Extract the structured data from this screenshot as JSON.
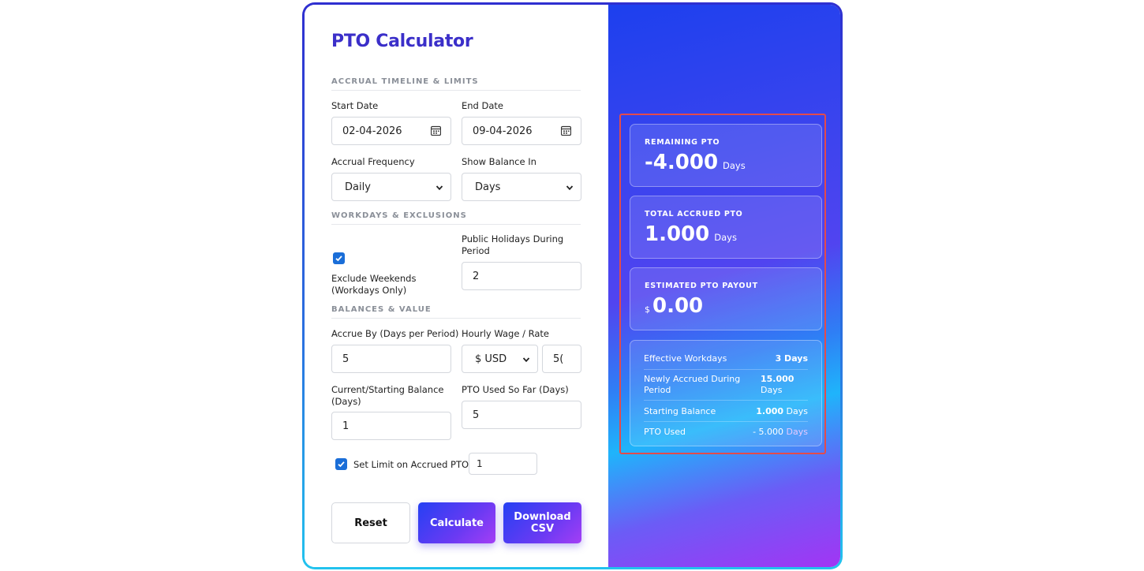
{
  "app": {
    "title": "PTO Calculator"
  },
  "sections": {
    "timeline": "ACCRUAL TIMELINE & LIMITS",
    "workdays": "WORKDAYS & EXCLUSIONS",
    "balances": "BALANCES & VALUE"
  },
  "form": {
    "start_date": {
      "label": "Start Date",
      "value": "02-04-2026"
    },
    "end_date": {
      "label": "End Date",
      "value": "09-04-2026"
    },
    "frequency": {
      "label": "Accrual Frequency",
      "value": "Daily"
    },
    "show_balance": {
      "label": "Show Balance In",
      "value": "Days"
    },
    "exclude_weekends": {
      "label": "Exclude Weekends (Workdays Only)",
      "checked": true
    },
    "holidays": {
      "label": "Public Holidays During Period",
      "value": "2"
    },
    "accrue_by": {
      "label": "Accrue By (Days per Period)",
      "value": "5"
    },
    "wage": {
      "label": "Hourly Wage / Rate",
      "currency": "$ USD",
      "value": "5("
    },
    "starting_balance": {
      "label": "Current/Starting Balance (Days)",
      "value": "1"
    },
    "pto_used": {
      "label": "PTO Used So Far (Days)",
      "value": "5"
    },
    "limit": {
      "label": "Set Limit on Accrued PTO",
      "checked": true,
      "value": "1"
    }
  },
  "buttons": {
    "reset": "Reset",
    "calculate": "Calculate",
    "download": "Download CSV"
  },
  "results": {
    "remaining": {
      "title": "REMAINING PTO",
      "value": "-4.000",
      "unit": "Days"
    },
    "accrued": {
      "title": "TOTAL ACCRUED PTO",
      "value": "1.000",
      "unit": "Days"
    },
    "payout": {
      "title": "ESTIMATED PTO PAYOUT",
      "currency": "$",
      "value": "0.00"
    },
    "details": [
      {
        "key": "Effective Workdays",
        "value": "3 Days",
        "unit": ""
      },
      {
        "key": "Newly Accrued During Period",
        "value": "15.000",
        "unit": "Days"
      },
      {
        "key": "Starting Balance",
        "value": "1.000",
        "unit": "Days"
      },
      {
        "key": "PTO Used",
        "value": "- 5.000",
        "unit": "Days"
      }
    ]
  },
  "colors": {
    "accent": "#3b2fc9",
    "highlight": "#e34b4b",
    "checkbox": "#1a6ed8"
  }
}
